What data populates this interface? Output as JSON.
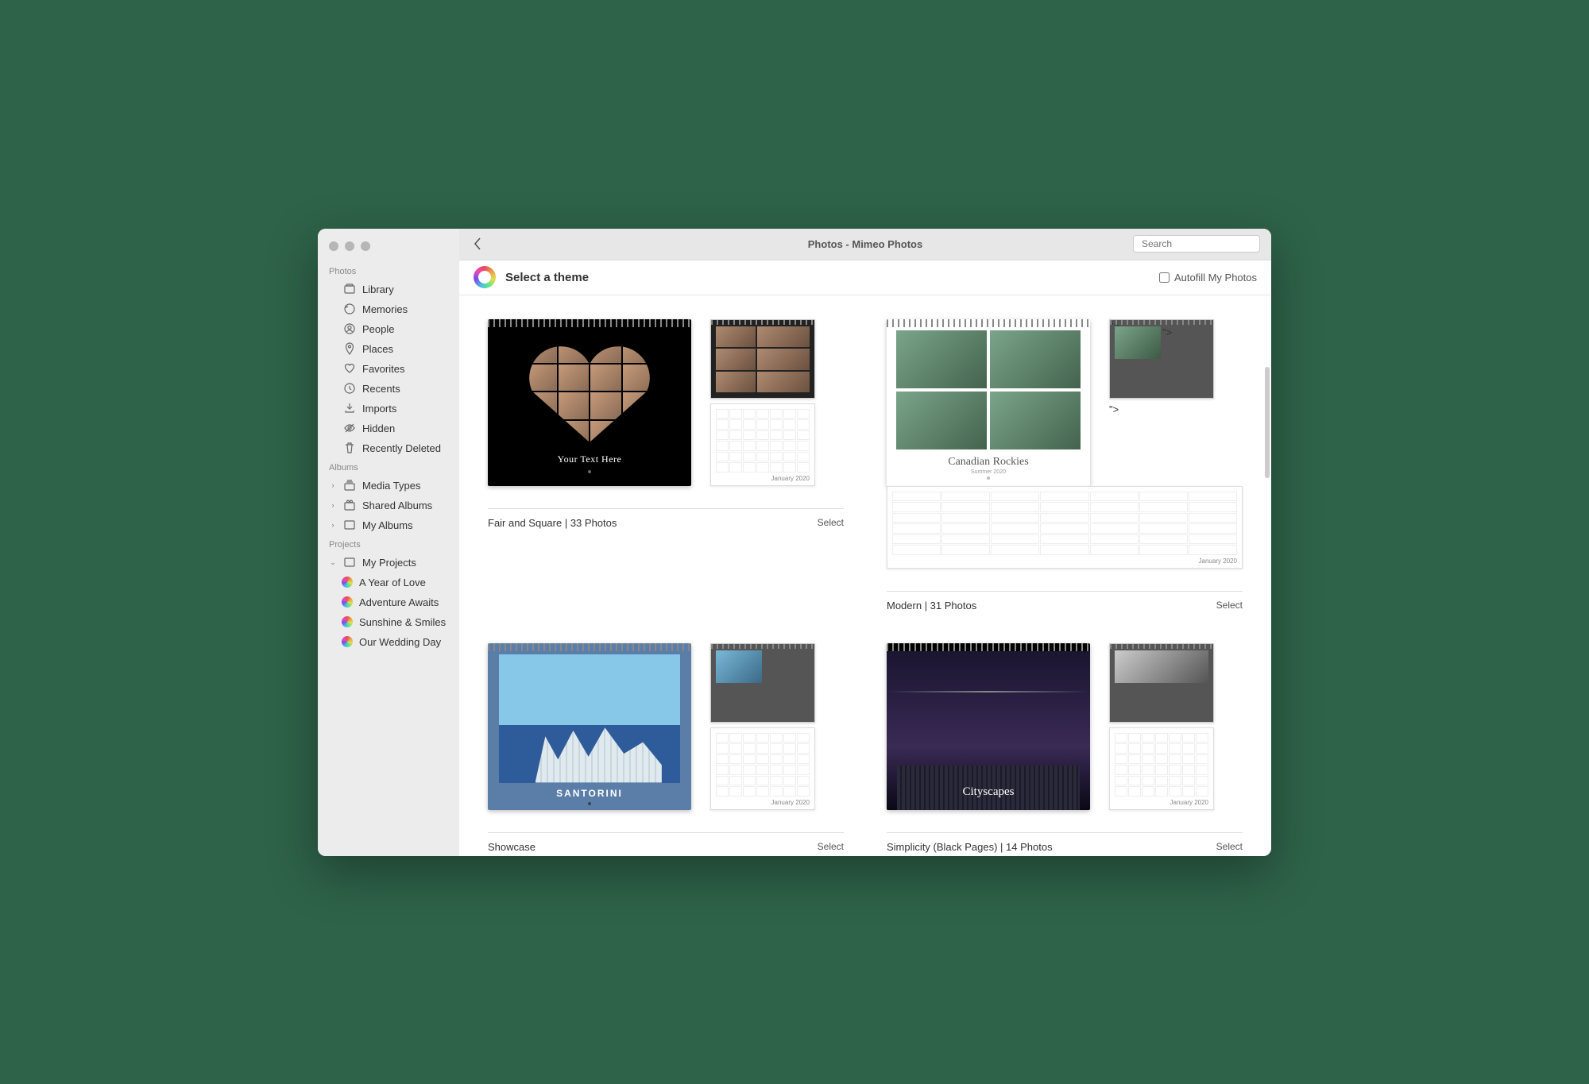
{
  "window_title": "Photos - Mimeo Photos",
  "search_placeholder": "Search",
  "subheader_title": "Select a theme",
  "autofill_label": "Autofill My Photos",
  "sidebar": {
    "sections": [
      {
        "title": "Photos",
        "items": [
          {
            "label": "Library",
            "icon": "photo-stack-icon"
          },
          {
            "label": "Memories",
            "icon": "clock-arrow-icon"
          },
          {
            "label": "People",
            "icon": "person-circle-icon"
          },
          {
            "label": "Places",
            "icon": "pin-icon"
          },
          {
            "label": "Favorites",
            "icon": "heart-icon"
          },
          {
            "label": "Recents",
            "icon": "clock-icon"
          },
          {
            "label": "Imports",
            "icon": "download-tray-icon"
          },
          {
            "label": "Hidden",
            "icon": "eye-slash-icon"
          },
          {
            "label": "Recently Deleted",
            "icon": "trash-icon"
          }
        ]
      },
      {
        "title": "Albums",
        "items": [
          {
            "label": "Media Types",
            "icon": "stack-icon",
            "chevron": true
          },
          {
            "label": "Shared Albums",
            "icon": "shared-icon",
            "chevron": true
          },
          {
            "label": "My Albums",
            "icon": "album-icon",
            "chevron": true
          }
        ]
      },
      {
        "title": "Projects",
        "items": [
          {
            "label": "My Projects",
            "icon": "album-icon",
            "chevron": true,
            "expanded": true,
            "children": [
              {
                "label": "A Year of Love"
              },
              {
                "label": "Adventure Awaits"
              },
              {
                "label": "Sunshine & Smiles"
              },
              {
                "label": "Our Wedding Day"
              }
            ]
          }
        ]
      }
    ]
  },
  "themes": [
    {
      "name": "Fair and Square | 33 Photos",
      "cover_style": "heart",
      "cover_caption": "Your Text Here",
      "select_label": "Select",
      "preview_month": "January 2020"
    },
    {
      "name": "Modern | 31 Photos",
      "cover_style": "modern",
      "cover_caption": "Canadian Rockies",
      "cover_subcaption": "Summer 2020",
      "select_label": "Select",
      "preview_month": "January 2020"
    },
    {
      "name": "Showcase",
      "cover_style": "showcase",
      "cover_caption": "SANTORINI",
      "select_label": "Select",
      "preview_month": "January 2020"
    },
    {
      "name": "Simplicity (Black Pages) | 14 Photos",
      "cover_style": "city",
      "cover_caption": "Cityscapes",
      "select_label": "Select",
      "preview_month": "January 2020"
    }
  ]
}
